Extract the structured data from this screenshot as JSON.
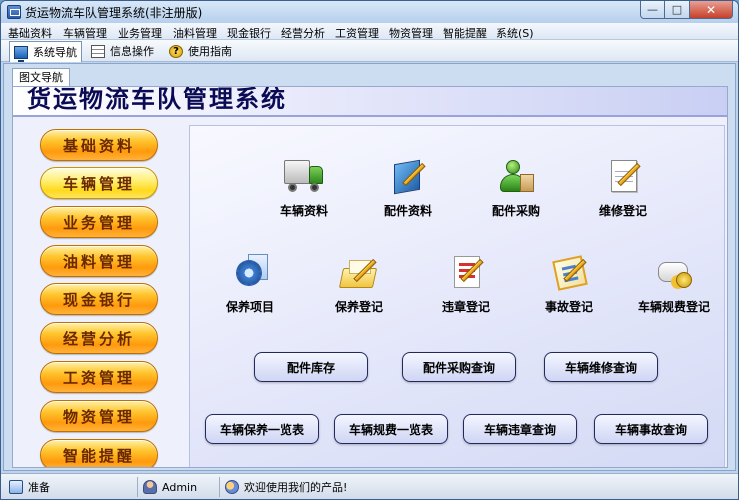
{
  "window": {
    "title": "货运物流车队管理系统(非注册版)",
    "controls": {
      "minimize": "—",
      "maximize": "□",
      "close": "✕"
    }
  },
  "menubar": {
    "items": [
      "基础资料",
      "车辆管理",
      "业务管理",
      "油料管理",
      "现金银行",
      "经营分析",
      "工资管理",
      "物资管理",
      "智能提醒",
      "系统(S)"
    ]
  },
  "toolbar": {
    "items": [
      {
        "label": "系统导航",
        "icon": "monitor-icon",
        "active": true
      },
      {
        "label": "信息操作",
        "icon": "grid-icon",
        "active": false
      },
      {
        "label": "使用指南",
        "icon": "help-icon",
        "active": false
      }
    ]
  },
  "doc_tab": {
    "label": "图文导航"
  },
  "banner": {
    "title": "货运物流车队管理系统"
  },
  "sidebar": {
    "items": [
      "基础资料",
      "车辆管理",
      "业务管理",
      "油料管理",
      "现金银行",
      "经营分析",
      "工资管理",
      "物资管理",
      "智能提醒"
    ],
    "active_index": 1
  },
  "features": {
    "row1": [
      {
        "label": "车辆资料",
        "icon": "truck-icon"
      },
      {
        "label": "配件资料",
        "icon": "book-pen-icon"
      },
      {
        "label": "配件采购",
        "icon": "person-bag-icon"
      },
      {
        "label": "维修登记",
        "icon": "notepad-pen-icon"
      }
    ],
    "row2": [
      {
        "label": "保养项目",
        "icon": "gear-doc-icon"
      },
      {
        "label": "保养登记",
        "icon": "folder-pen-icon"
      },
      {
        "label": "违章登记",
        "icon": "document-pen-icon"
      },
      {
        "label": "事故登记",
        "icon": "clipboard-pen-icon"
      },
      {
        "label": "车辆规费登记",
        "icon": "scroll-coins-icon"
      }
    ]
  },
  "actions": {
    "row1": [
      "配件库存",
      "配件采购查询",
      "车辆维修查询"
    ],
    "row2": [
      "车辆保养一览表",
      "车辆规费一览表",
      "车辆违章查询",
      "车辆事故查询"
    ]
  },
  "statusbar": {
    "status": "准备",
    "user": "Admin",
    "message": "欢迎使用我们的产品!"
  },
  "colors": {
    "sidebar_button": "#ffb020",
    "sidebar_button_active": "#ffe84a",
    "sidebar_text": "#6a2800",
    "banner_text": "#0a0a55",
    "action_border": "#222a5c"
  }
}
